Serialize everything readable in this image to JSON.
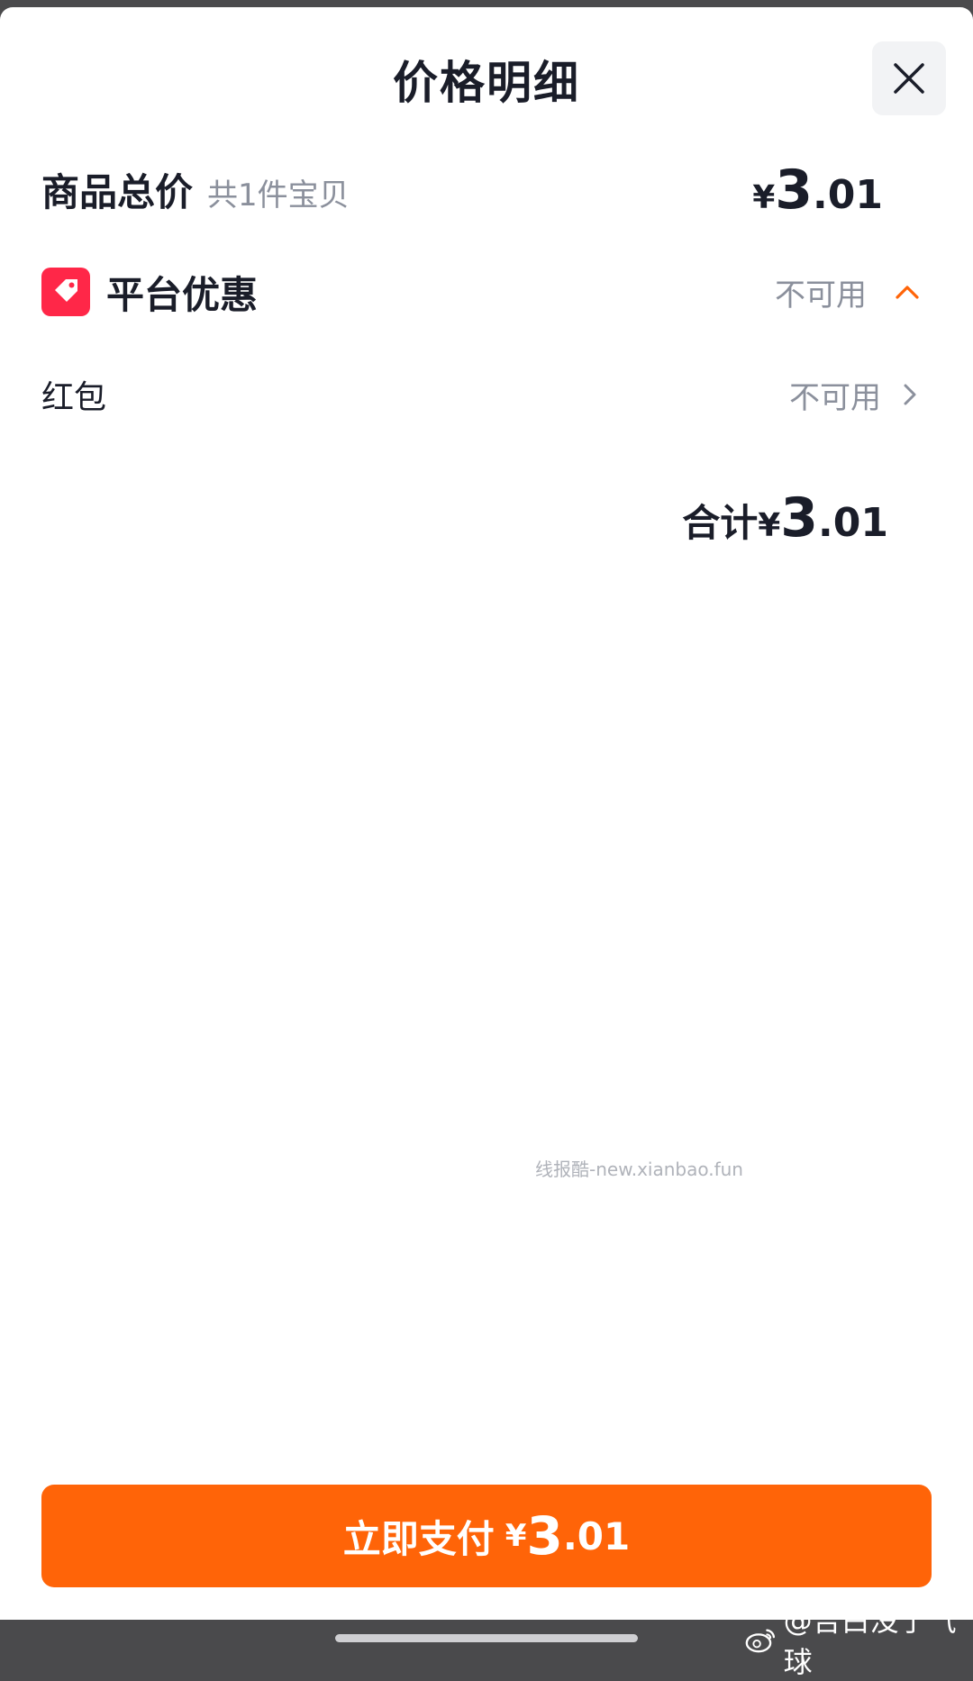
{
  "sheet": {
    "title": "价格明细"
  },
  "goods_total": {
    "label": "商品总价",
    "count_text": "共1件宝贝",
    "currency": "¥",
    "price_int": "3",
    "price_dec": ".01"
  },
  "platform_discount": {
    "label": "平台优惠",
    "status": "不可用"
  },
  "red_packet": {
    "label": "红包",
    "status": "不可用"
  },
  "total": {
    "label": "合计",
    "currency": "¥",
    "price_int": "3",
    "price_dec": ".01"
  },
  "pay_button": {
    "label": "立即支付",
    "currency": "¥",
    "price_int": "3",
    "price_dec": ".01"
  },
  "watermark": "线报酷-new.xianbao.fun",
  "credit": "@告白没了气球",
  "colors": {
    "accent_orange": "#ff6408",
    "tag_red": "#ff2748",
    "text_dark": "#1a1d29",
    "text_muted": "#8b909c"
  },
  "icons": [
    "close-icon",
    "tag-icon",
    "chevron-up-icon",
    "chevron-right-icon",
    "weibo-icon"
  ]
}
